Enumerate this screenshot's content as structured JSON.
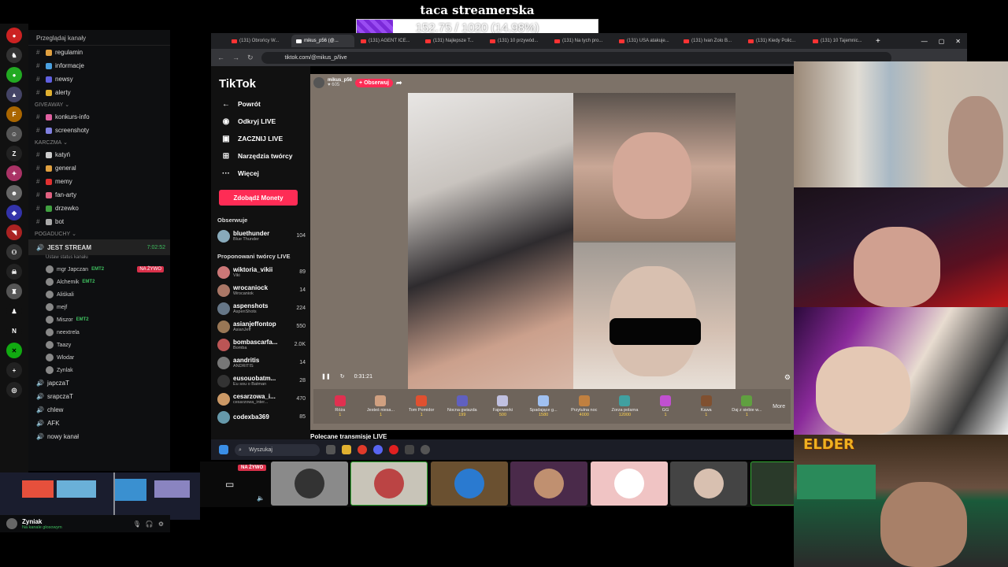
{
  "donation": {
    "title": "taca streamerska",
    "progress_text": "152.75 / 1020 (14.98%)",
    "progress": 0.1498
  },
  "discord": {
    "browse": "Przeglądaj kanały",
    "channels": [
      {
        "name": "regulamin",
        "color": "#e0a040"
      },
      {
        "name": "informacje",
        "color": "#4aa0e0"
      },
      {
        "name": "newsy",
        "color": "#6060e0"
      },
      {
        "name": "alerty",
        "color": "#e0b030"
      }
    ],
    "cat_giveaway": "GIVEAWAY",
    "giveaway": [
      {
        "name": "konkurs-info",
        "color": "#e060a0"
      },
      {
        "name": "screenshoty",
        "color": "#8080e0"
      }
    ],
    "cat_karczma": "KARCZMA",
    "karczma": [
      {
        "name": "katyń",
        "color": "#ccc"
      },
      {
        "name": "general",
        "color": "#e0a040"
      },
      {
        "name": "memy",
        "color": "#e03030"
      },
      {
        "name": "fan-arty",
        "color": "#e06080"
      },
      {
        "name": "drzewko",
        "color": "#40a040"
      },
      {
        "name": "bot",
        "color": "#aaa"
      }
    ],
    "cat_pogaduchy": "POGADUCHY",
    "voice_main": "JEST STREAM",
    "voice_time": "7:02:52",
    "voice_status": "Ustaw status kanału",
    "voice_users": [
      {
        "name": "mgr Japczan",
        "tag": "EMT2",
        "live": "NA ŻYWO"
      },
      {
        "name": "Alchemik",
        "tag": "EMT2"
      },
      {
        "name": "Aliśkali"
      },
      {
        "name": "mejf"
      },
      {
        "name": "Miszor",
        "tag": "EMT2"
      },
      {
        "name": "neextrela"
      },
      {
        "name": "Taazy"
      },
      {
        "name": "Wlodar"
      },
      {
        "name": "Zynlak"
      }
    ],
    "other_voice": [
      "japczaT",
      "srapczaT",
      "chlew",
      "AFK",
      "nowy kanał"
    ],
    "user_name": "Zyniak",
    "user_status": "Na kanale głosowym"
  },
  "browser": {
    "tabs": [
      "(131) Obrońcy W...",
      "mikus_p56 (@...",
      "(131) AGENT ICE...",
      "(131) Najlepsze T...",
      "(131) 10 przywód...",
      "(131) Na tych pro...",
      "(131) USA atakuje...",
      "(131) Ivan Zolo B...",
      "(131) Kiedy Polic...",
      "(131) 10 Tajemnic..."
    ],
    "url": "tiktok.com/@mikus_p/live"
  },
  "tiktok": {
    "logo": "TikTok",
    "nav": [
      {
        "icon": "←",
        "label": "Powrót"
      },
      {
        "icon": "◉",
        "label": "Odkryj LIVE"
      },
      {
        "icon": "▣",
        "label": "ZACZNIJ LIVE"
      },
      {
        "icon": "⊞",
        "label": "Narzędzia twórcy"
      },
      {
        "icon": "···",
        "label": "Więcej"
      }
    ],
    "coins": "Zdobądź Monety",
    "following_label": "Obserwuje",
    "following": [
      {
        "name": "bluethunder",
        "sub": "Blue Thunder",
        "count": "104",
        "color": "#8ab"
      }
    ],
    "suggested_label": "Proponowani twórcy LIVE",
    "suggested": [
      {
        "name": "wiktoria_vikii",
        "sub": "Viki",
        "count": "89",
        "color": "#c77"
      },
      {
        "name": "wrocaniock",
        "sub": "Wrocaniok",
        "count": "14",
        "color": "#a76"
      },
      {
        "name": "aspenshots",
        "sub": "AspenShots",
        "count": "224",
        "color": "#678"
      },
      {
        "name": "asianjeffontop",
        "sub": "AsianJeff",
        "count": "550",
        "color": "#975"
      },
      {
        "name": "bombascarfa...",
        "sub": "Bomba",
        "count": "2.0K",
        "color": "#b55"
      },
      {
        "name": "aandritis",
        "sub": "ANDRITIS",
        "count": "14",
        "color": "#777"
      },
      {
        "name": "eusouobatm...",
        "sub": "Eu sou o Batman",
        "count": "28",
        "color": "#333"
      },
      {
        "name": "cesarzowa_i...",
        "sub": "cesarzowa_inter...",
        "count": "470",
        "color": "#c96"
      },
      {
        "name": "codexba369",
        "sub": "",
        "count": "85",
        "color": "#69a"
      }
    ],
    "host": "mikus_p56",
    "host_likes": "♥ 605",
    "follow": "+ Obserwuj",
    "time": "0:31:21",
    "gifts": [
      {
        "name": "Róża",
        "price": "1",
        "color": "#e03050"
      },
      {
        "name": "Jesteś niesa...",
        "price": "1",
        "color": "#d0a080"
      },
      {
        "name": "Tom Pomidor",
        "price": "1",
        "color": "#e05030"
      },
      {
        "name": "Nocna gwiazda",
        "price": "199",
        "color": "#6060c0"
      },
      {
        "name": "Fajerwerki",
        "price": "500",
        "color": "#c0c0e0"
      },
      {
        "name": "Spadające g...",
        "price": "1580",
        "color": "#a0c0f0"
      },
      {
        "name": "Przytulna noc",
        "price": "4000",
        "color": "#c08040"
      },
      {
        "name": "Zorza polarna",
        "price": "12000",
        "color": "#40a0a0"
      },
      {
        "name": "GG",
        "price": "1",
        "color": "#c050d0"
      },
      {
        "name": "Kawa",
        "price": "1",
        "color": "#805030"
      },
      {
        "name": "Daj z siebie w...",
        "price": "1",
        "color": "#60a040"
      }
    ],
    "more": "More",
    "recommended": "Polecane transmisje LIVE"
  },
  "taskbar": {
    "search": "Wyszukaj"
  },
  "stream": {
    "live": "NA ŻYWO"
  },
  "overlay": {
    "elder": "ELDER"
  }
}
